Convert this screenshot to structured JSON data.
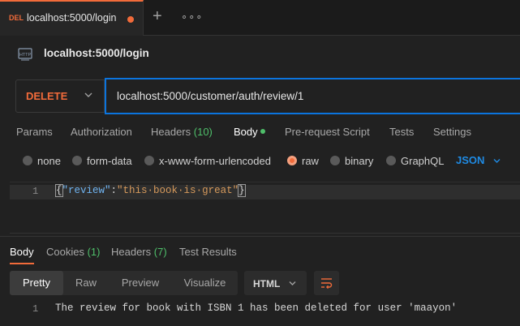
{
  "tab": {
    "method": "DEL",
    "title": "localhost:5000/login",
    "new_tab": "+",
    "more": "∘∘∘"
  },
  "request": {
    "icon": "http-icon",
    "name": "localhost:5000/login",
    "method": "DELETE",
    "url": "localhost:5000/customer/auth/review/1"
  },
  "request_tabs": {
    "params": "Params",
    "authorization": "Authorization",
    "headers": "Headers",
    "headers_count": "(10)",
    "body": "Body",
    "pre_request": "Pre-request Script",
    "tests": "Tests",
    "settings": "Settings"
  },
  "body_types": {
    "none": "none",
    "form_data": "form-data",
    "urlencoded": "x-www-form-urlencoded",
    "raw": "raw",
    "binary": "binary",
    "graphql": "GraphQL",
    "selected": "raw",
    "format": "JSON"
  },
  "editor": {
    "line_number": "1",
    "brace_open": "{",
    "key": "\"review\"",
    "colon": ":",
    "value": "\"this·book·is·great\"",
    "brace_close": "}"
  },
  "response_tabs": {
    "body": "Body",
    "cookies": "Cookies",
    "cookies_count": "(1)",
    "headers": "Headers",
    "headers_count": "(7)",
    "test_results": "Test Results"
  },
  "response_view": {
    "pretty": "Pretty",
    "raw": "Raw",
    "preview": "Preview",
    "visualize": "Visualize",
    "format": "HTML"
  },
  "response_body": {
    "line_number": "1",
    "text": "The review for book with ISBN 1 has been deleted for user 'maayon'"
  },
  "colors": {
    "accent": "#f26b3a",
    "url_focus": "#0b74de",
    "json_blue": "#1f8be4",
    "green": "#4fbf6a"
  }
}
